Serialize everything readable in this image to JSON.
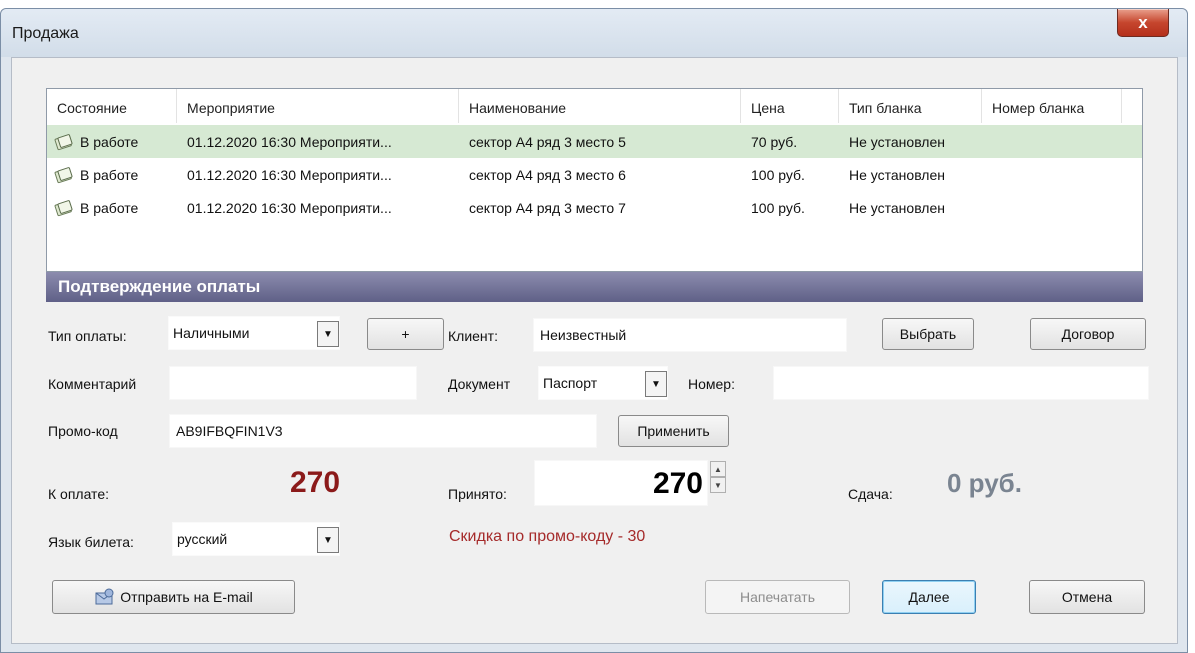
{
  "window": {
    "title": "Продажа",
    "close_label": "x"
  },
  "table": {
    "columns": [
      "Состояние",
      "Мероприятие",
      "Наименование",
      "Цена",
      "Тип бланка",
      "Номер бланка"
    ],
    "rows": [
      {
        "state": "В работе",
        "event": "01.12.2020 16:30 Мероприяти...",
        "name": "сектор А4 ряд 3 место 5",
        "price": "70 руб.",
        "blank_type": "Не установлен",
        "blank_number": ""
      },
      {
        "state": "В работе",
        "event": "01.12.2020 16:30 Мероприяти...",
        "name": "сектор А4 ряд 3 место 6",
        "price": "100 руб.",
        "blank_type": "Не установлен",
        "blank_number": ""
      },
      {
        "state": "В работе",
        "event": "01.12.2020 16:30 Мероприяти...",
        "name": "сектор А4 ряд 3 место 7",
        "price": "100 руб.",
        "blank_type": "Не установлен",
        "blank_number": ""
      }
    ],
    "selected_row_color": "#d6e9d3"
  },
  "payment": {
    "header": "Подтверждение оплаты",
    "pay_type_label": "Тип оплаты:",
    "pay_type_value": "Наличными",
    "add_label": "+",
    "client_label": "Клиент:",
    "client_value": "Неизвестный",
    "choose_label": "Выбрать",
    "contract_label": "Договор",
    "comment_label": "Комментарий",
    "comment_value": "",
    "document_label": "Документ",
    "document_value": "Паспорт",
    "number_label": "Номер:",
    "number_value": "",
    "promo_label": "Промо-код",
    "promo_value": "AB9IFBQFIN1V3",
    "apply_label": "Применить",
    "to_pay_label": "К оплате:",
    "to_pay_value": "270",
    "accepted_label": "Принято:",
    "accepted_value": "270",
    "change_label": "Сдача:",
    "change_value": "0 руб.",
    "language_label": "Язык билета:",
    "language_value": "русский",
    "promo_discount": "Скидка по промо-коду - 30"
  },
  "footer": {
    "email_label": "Отправить на E-mail",
    "print_label": "Напечатать",
    "next_label": "Далее",
    "cancel_label": "Отмена"
  },
  "colors": {
    "header_bar": "#6d6d94",
    "amount_red": "#8b1a1a",
    "promo_text": "#a52a2a",
    "accent_blue": "#3c7fb1"
  }
}
